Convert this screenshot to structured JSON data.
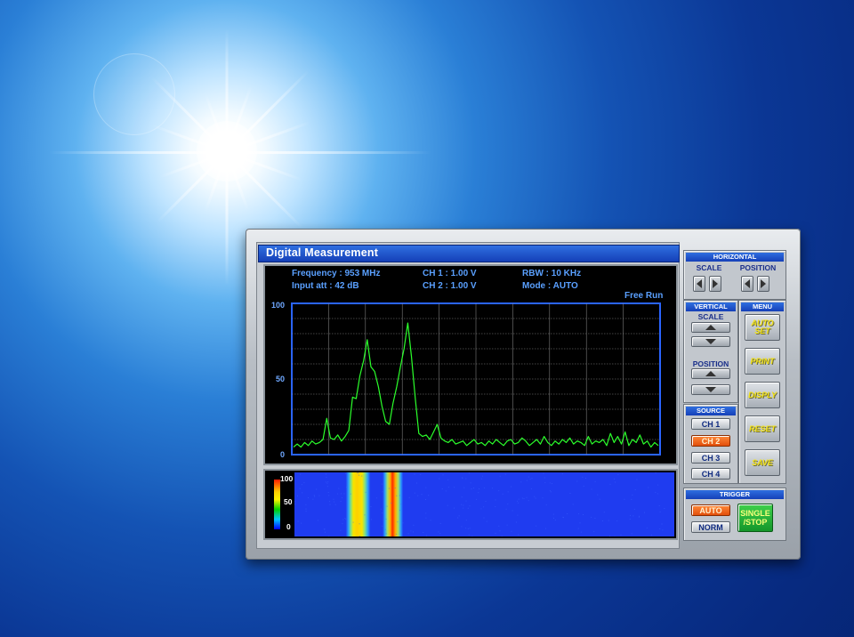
{
  "window": {
    "title": "Digital Measurement"
  },
  "readouts": {
    "frequency": "Frequency :  953 MHz",
    "input_att": "Input att :  42 dB",
    "ch1": "CH 1 :  1.00 V",
    "ch2": "CH 2 :  1.00 V",
    "rbw": "RBW :  10 KHz",
    "mode": "Mode :  AUTO",
    "run_state": "Free Run"
  },
  "chart_data": {
    "type": "line",
    "yticks": [
      "100",
      "50",
      "0"
    ],
    "ylim": [
      0,
      100
    ],
    "xlim": [
      0,
      100
    ],
    "grid": true,
    "series": [
      {
        "color": "#2bff2b",
        "values": [
          5,
          7,
          5,
          8,
          6,
          9,
          7,
          8,
          10,
          24,
          11,
          10,
          13,
          9,
          12,
          16,
          38,
          37,
          52,
          62,
          76,
          58,
          55,
          45,
          32,
          22,
          20,
          34,
          45,
          58,
          70,
          87,
          65,
          38,
          14,
          12,
          13,
          10,
          15,
          20,
          11,
          9,
          8,
          10,
          7,
          8,
          9,
          6,
          8,
          10,
          7,
          8,
          6,
          9,
          7,
          10,
          8,
          6,
          9,
          10,
          7,
          8,
          11,
          9,
          6,
          8,
          10,
          7,
          12,
          8,
          6,
          9,
          7,
          10,
          8,
          11,
          7,
          9,
          8,
          6,
          12,
          7,
          9,
          8,
          10,
          6,
          14,
          8,
          12,
          7,
          15,
          6,
          10,
          8,
          13,
          7,
          9,
          5,
          8,
          6
        ]
      }
    ]
  },
  "colorbar": {
    "labels": [
      "100",
      "50",
      "0"
    ]
  },
  "horizontal": {
    "title": "HORIZONTAL",
    "scale_label": "SCALE",
    "position_label": "POSITION"
  },
  "vertical": {
    "title": "VERTICAL",
    "scale_label": "SCALE",
    "position_label": "POSITION"
  },
  "source": {
    "title": "SOURCE",
    "channels": [
      "CH 1",
      "CH 2",
      "CH 3",
      "CH 4"
    ],
    "active": "CH 2"
  },
  "menu": {
    "title": "MENU",
    "items": [
      "AUTO SET",
      "PRINT",
      "DISPLY",
      "RESET",
      "SAVE"
    ]
  },
  "trigger": {
    "title": "TRIGGER",
    "auto": "AUTO",
    "norm": "NORM",
    "single_stop": "SINGLE /STOP"
  },
  "colors": {
    "trace": "#2bff2b",
    "accent": "#1540b8",
    "active_button": "#ff6a1a",
    "single_button": "#2bbf3a"
  }
}
